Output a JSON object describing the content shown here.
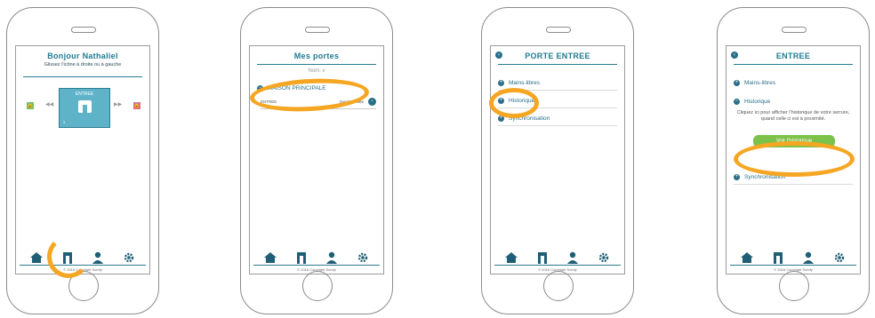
{
  "colors": {
    "accent": "#1f7b93",
    "ring": "#f5a623",
    "green": "#7cc24a",
    "door": "#5fb3c9",
    "lock_green": "#7bbf58",
    "lock_red": "#e56a7c"
  },
  "screen1": {
    "title": "Bonjour Nathaliel",
    "subtitle": "Glissez l'icône à droite ou à gauche",
    "door_label": "ENTREE",
    "door_small": "3",
    "copyright": "© 2016 Copyright Somfy"
  },
  "screen2": {
    "title": "Mes portes",
    "section": "Nom: v",
    "item": "MAISON PRINCIPALE",
    "sub_left": "ENTREE",
    "sub_right": "Synchronisée",
    "copyright": "© 2016 Copyright Somfy"
  },
  "screen3": {
    "title": "PORTE ENTREE",
    "rows": [
      "Mains-libres",
      "Historique",
      "Synchronisation"
    ],
    "copyright": "© 2016 Copyright Somfy"
  },
  "screen4": {
    "title": "ENTREE",
    "row1": "Mains-libres",
    "row2": "Historique",
    "message": "Cliquez ici pour afficher l'historique de votre serrure, quand celle ci est à proximité.",
    "button": "Voir l'historique",
    "row3": "Synchronisation",
    "copyright": "© 2016 Copyright Somfy"
  },
  "icons": {
    "home": "house-icon",
    "door": "door-icon",
    "user": "user-icon",
    "settings": "gear-icon"
  }
}
